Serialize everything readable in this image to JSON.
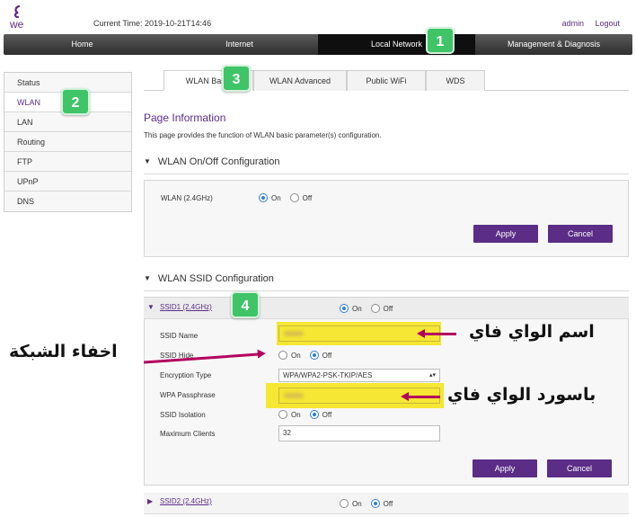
{
  "header": {
    "brand": "we",
    "current_time_label": "Current Time: 2019-10-21T14:46",
    "user": "admin",
    "logout": "Logout",
    "brand_color": "#5b2d86"
  },
  "main_nav": {
    "items": [
      "Home",
      "Internet",
      "Local Network",
      "Management & Diagnosis"
    ],
    "active": "Local Network"
  },
  "sidebar": {
    "items": [
      "Status",
      "WLAN",
      "LAN",
      "Routing",
      "FTP",
      "UPnP",
      "DNS"
    ],
    "active": "WLAN"
  },
  "tabs": {
    "items": [
      "WLAN Basic",
      "WLAN Advanced",
      "Public WiFi",
      "WDS"
    ],
    "active": "WLAN Basic"
  },
  "page_info": {
    "title": "Page Information",
    "description": "This page provides the function of WLAN basic parameter(s) configuration."
  },
  "onoff_section": {
    "title": "WLAN On/Off Configuration",
    "wlan_label": "WLAN (2.4GHz)",
    "on_label": "On",
    "off_label": "Off",
    "selected": "On",
    "apply": "Apply",
    "cancel": "Cancel"
  },
  "ssid_section": {
    "title": "WLAN SSID Configuration",
    "ssid1": {
      "title": "SSID1 (2.4GHz)",
      "state": "On",
      "on_label": "On",
      "off_label": "Off",
      "ssid_name_label": "SSID Name",
      "ssid_hide_label": "SSID Hide",
      "ssid_hide_on": "On",
      "ssid_hide_off": "Off",
      "ssid_hide_selected": "Off",
      "encryption_label": "Encryption Type",
      "encryption_value": "WPA/WPA2-PSK-TKIP/AES",
      "passphrase_label": "WPA Passphrase",
      "isolation_label": "SSID Isolation",
      "isolation_on": "On",
      "isolation_off": "Off",
      "isolation_selected": "Off",
      "max_clients_label": "Maximum Clients",
      "max_clients_value": "32",
      "apply": "Apply",
      "cancel": "Cancel"
    },
    "ssid2": {
      "title": "SSID2 (2.4GHz)",
      "on_label": "On",
      "off_label": "Off",
      "state": "Off"
    }
  },
  "annotations": {
    "badges": [
      "1",
      "2",
      "3",
      "4"
    ],
    "wifi_name": "اسم الواي فاي",
    "wifi_password": "باسورد الواي فاي",
    "hide_network": "اخفاء الشبكة",
    "highlight_color": "#f4e522",
    "arrow_color": "#b3005e",
    "badge_color": "#3fc467"
  }
}
